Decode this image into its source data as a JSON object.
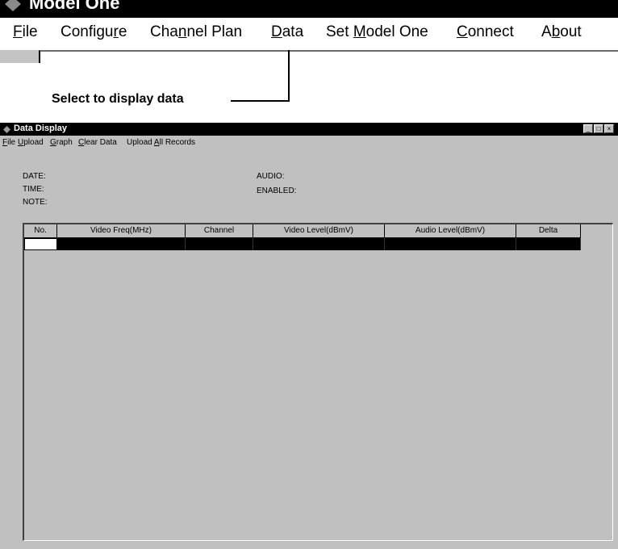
{
  "app": {
    "title": "Model One",
    "menu": [
      {
        "pre": "",
        "u": "F",
        "post": "ile"
      },
      {
        "pre": "Configu",
        "u": "r",
        "post": "e"
      },
      {
        "pre": "Cha",
        "u": "n",
        "post": "nel Plan"
      },
      {
        "pre": "",
        "u": "D",
        "post": "ata"
      },
      {
        "pre": "Set ",
        "u": "M",
        "post": "odel One"
      },
      {
        "pre": "",
        "u": "C",
        "post": "onnect"
      },
      {
        "pre": "A",
        "u": "b",
        "post": "out"
      }
    ]
  },
  "callout": {
    "text": "Select to display data"
  },
  "data_display": {
    "title": "Data Display",
    "menu": [
      {
        "pre": "",
        "u": "F",
        "post": "ile"
      },
      {
        "pre": "",
        "u": "U",
        "post": "pload"
      },
      {
        "pre": "",
        "u": "G",
        "post": "raph"
      },
      {
        "pre": "",
        "u": "C",
        "post": "lear Data"
      },
      {
        "pre": "Upload ",
        "u": "A",
        "post": "ll Records"
      }
    ],
    "info": {
      "date": "DATE:",
      "time": "TIME:",
      "note": "NOTE:",
      "audio": "AUDIO:",
      "enabled": "ENABLED:"
    },
    "table": {
      "columns": [
        "No.",
        "Video Freq(MHz)",
        "Channel",
        "Video Level(dBmV)",
        "Audio Level(dBmV)",
        "Delta"
      ]
    }
  }
}
